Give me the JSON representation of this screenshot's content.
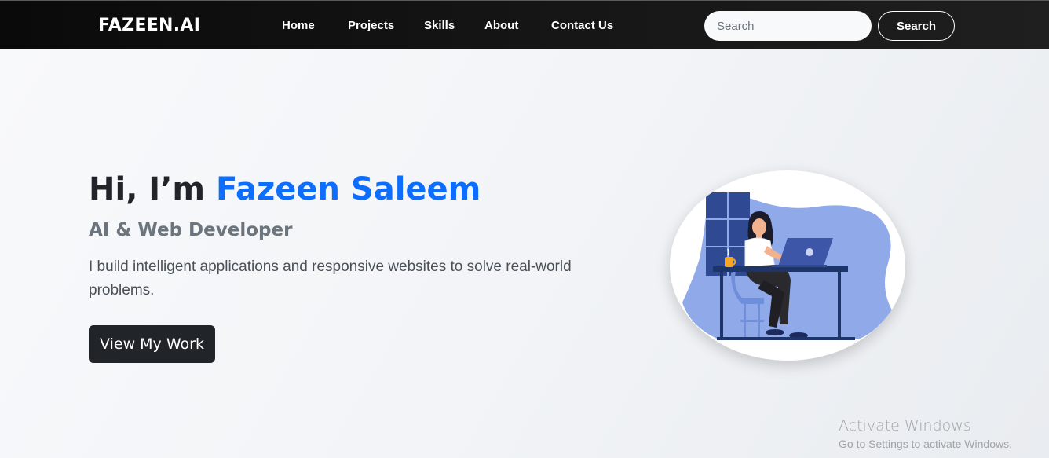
{
  "navbar": {
    "brand": "FAZEEN.AI",
    "links": [
      "Home",
      "Projects",
      "Skills",
      "About",
      "Contact Us"
    ],
    "search": {
      "placeholder": "Search",
      "value": "",
      "button_label": "Search"
    }
  },
  "hero": {
    "title_prefix": "Hi, I’m ",
    "title_name": "Fazeen Saleem",
    "subtitle": "AI & Web Developer",
    "description": "I build intelligent applications and responsive websites to solve real-world problems.",
    "cta_label": "View My Work",
    "illustration": "developer-at-desk-illustration"
  },
  "watermark": {
    "title": "Activate Windows",
    "subtitle": "Go to Settings to activate Windows."
  },
  "colors": {
    "navbar_bg": "#111111",
    "accent": "#0d6efd",
    "text_dark": "#212529",
    "text_muted": "#6c757d",
    "illustration_blue": "#8fa9e9",
    "illustration_navy": "#1d3569"
  }
}
